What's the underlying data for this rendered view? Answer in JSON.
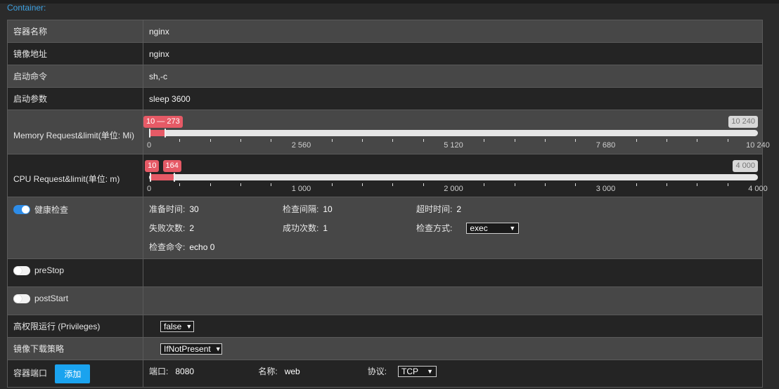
{
  "section_title": "Container:",
  "rows": {
    "name": {
      "label": "容器名称",
      "value": "nginx"
    },
    "image": {
      "label": "镜像地址",
      "value": "nginx"
    },
    "command": {
      "label": "启动命令",
      "value": "sh,-c"
    },
    "args": {
      "label": "启动参数",
      "value": "sleep 3600"
    }
  },
  "memory": {
    "label": "Memory Request&limit(单位: Mi)",
    "range_label": "10 — 273",
    "max_label": "10 240",
    "min": 0,
    "max": 10240,
    "low": 10,
    "high": 273,
    "ticks": [
      "0",
      "2 560",
      "5 120",
      "7 680",
      "10 240"
    ]
  },
  "cpu": {
    "label": "CPU Request&limit(单位: m)",
    "low_label": "10",
    "high_label": "164",
    "max_label": "4 000",
    "min": 0,
    "max": 4000,
    "low": 10,
    "high": 164,
    "ticks": [
      "0",
      "1 000",
      "2 000",
      "3 000",
      "4 000"
    ]
  },
  "health": {
    "label": "健康检查",
    "enabled": true,
    "ready_time_label": "准备时间:",
    "ready_time": "30",
    "interval_label": "检查间隔:",
    "interval": "10",
    "timeout_label": "超时时间:",
    "timeout": "2",
    "fail_label": "失败次数:",
    "fail": "2",
    "success_label": "成功次数:",
    "success": "1",
    "method_label": "检查方式:",
    "method": "exec",
    "command_label": "检查命令:",
    "command": "echo 0"
  },
  "prestop": {
    "label": "preStop",
    "enabled": false
  },
  "poststart": {
    "label": "postStart",
    "enabled": false
  },
  "privileged": {
    "label": "高权限运行 (Privileges)",
    "value": "false"
  },
  "pull_policy": {
    "label": "镜像下载策略",
    "value": "IfNotPresent"
  },
  "ports": {
    "label": "容器端口",
    "add_label": "添加",
    "port_label": "端口:",
    "port": "8080",
    "name_label": "名称:",
    "name": "web",
    "protocol_label": "协议:",
    "protocol": "TCP"
  },
  "colors": {
    "accent": "#1aa3ef",
    "range": "#e65a66",
    "toggle_on": "#2d8ce8",
    "title": "#3ea0e0"
  }
}
